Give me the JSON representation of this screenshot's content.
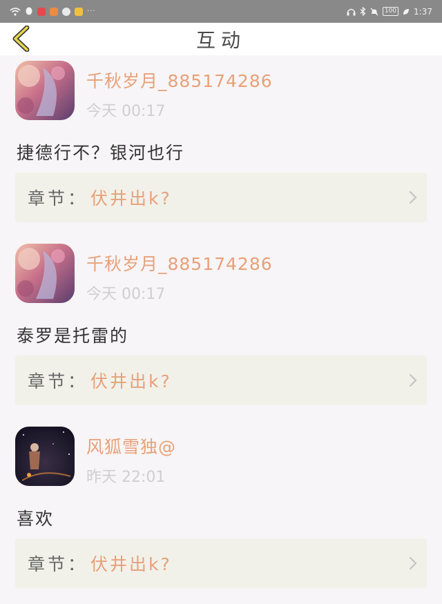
{
  "status_bar": {
    "time": "1:37",
    "battery": "100",
    "more": "···",
    "left_icons": [
      "wifi-icon",
      "qq-icon",
      "app-red-icon",
      "app-orange-icon",
      "app-circle-icon",
      "app-yellow-icon"
    ],
    "right_icons": [
      "headphones-icon",
      "bluetooth-icon",
      "mute-icon",
      "battery-icon",
      "leaf-icon"
    ]
  },
  "header": {
    "title": "互动",
    "back_icon": "chevron-left-icon"
  },
  "items": [
    {
      "username": "千秋岁月_885174286",
      "time": "今天 00:17",
      "comment": "捷德行不？银河也行",
      "chapter_label": "章节：",
      "chapter_value": "伏井出k?"
    },
    {
      "username": "千秋岁月_885174286",
      "time": "今天 00:17",
      "comment": "泰罗是托雷的",
      "chapter_label": "章节：",
      "chapter_value": "伏井出k?"
    },
    {
      "username": "风狐雪独@",
      "time": "昨天 22:01",
      "comment": "喜欢",
      "chapter_label": "章节：",
      "chapter_value": "伏井出k?"
    }
  ],
  "colors": {
    "accent": "#e8a078",
    "back_icon": "#e7d84a",
    "chapter_bg": "#f1f1ea",
    "page_bg": "#f7f5f7"
  }
}
